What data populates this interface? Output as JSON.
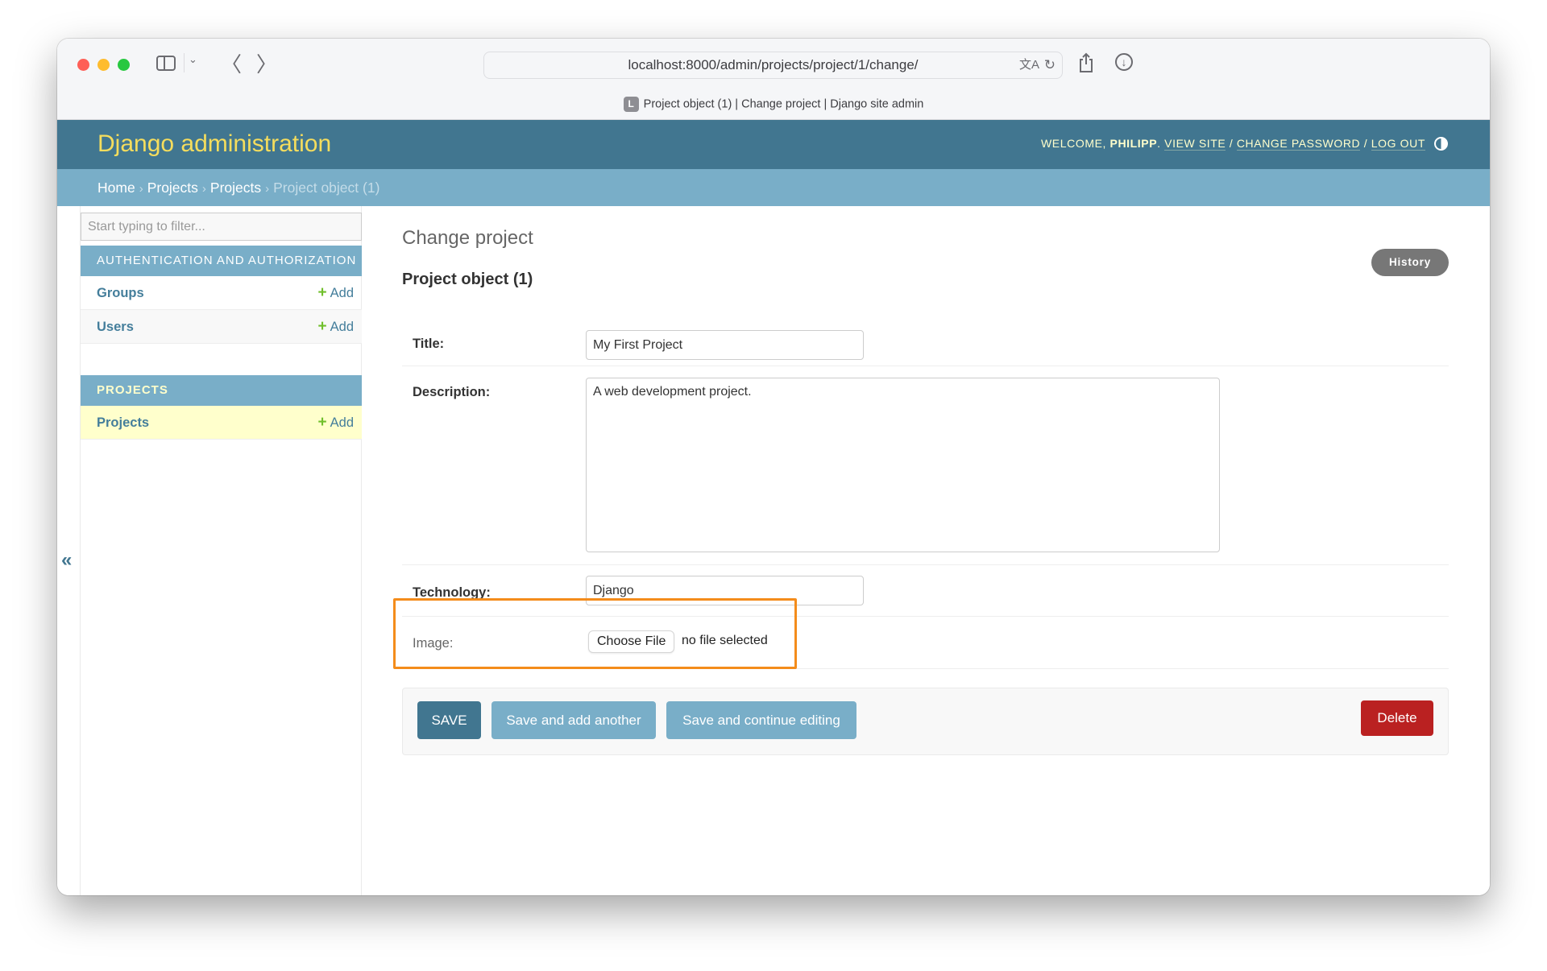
{
  "browser": {
    "url": "localhost:8000/admin/projects/project/1/change/",
    "tab_title": "Project object (1) | Change project | Django site admin",
    "favicon_letter": "L"
  },
  "header": {
    "branding": "Django administration",
    "welcome": "Welcome,",
    "username": "Philipp",
    "view_site": "View site",
    "change_password": "Change password",
    "log_out": "Log out",
    "separator": "/"
  },
  "breadcrumbs": {
    "home": "Home",
    "app": "Projects",
    "model": "Projects",
    "current": "Project object (1)",
    "separator": "›"
  },
  "sidebar": {
    "filter_placeholder": "Start typing to filter...",
    "collapse_glyph": "«",
    "modules": [
      {
        "caption": "Authentication and Authorization",
        "models": [
          {
            "name": "Groups",
            "add_label": "Add"
          },
          {
            "name": "Users",
            "add_label": "Add"
          }
        ]
      },
      {
        "caption": "Projects",
        "models": [
          {
            "name": "Projects",
            "add_label": "Add"
          }
        ]
      }
    ]
  },
  "content": {
    "title": "Change project",
    "object_title": "Project object (1)",
    "history_label": "History",
    "fields": {
      "title": {
        "label": "Title:",
        "value": "My First Project"
      },
      "description": {
        "label": "Description:",
        "value": "A web development project."
      },
      "technology": {
        "label": "Technology:",
        "value": "Django"
      },
      "image": {
        "label": "Image:",
        "button": "Choose File",
        "status": "no file selected"
      }
    },
    "buttons": {
      "save": "SAVE",
      "save_add_another": "Save and add another",
      "save_continue": "Save and continue editing",
      "delete": "Delete"
    }
  },
  "colors": {
    "header_bg": "#417690",
    "branding": "#f5dd5d",
    "breadcrumb_bg": "#79aec8",
    "delete": "#ba2121",
    "highlight": "#f48c1b",
    "add_plus": "#70bf2b"
  }
}
